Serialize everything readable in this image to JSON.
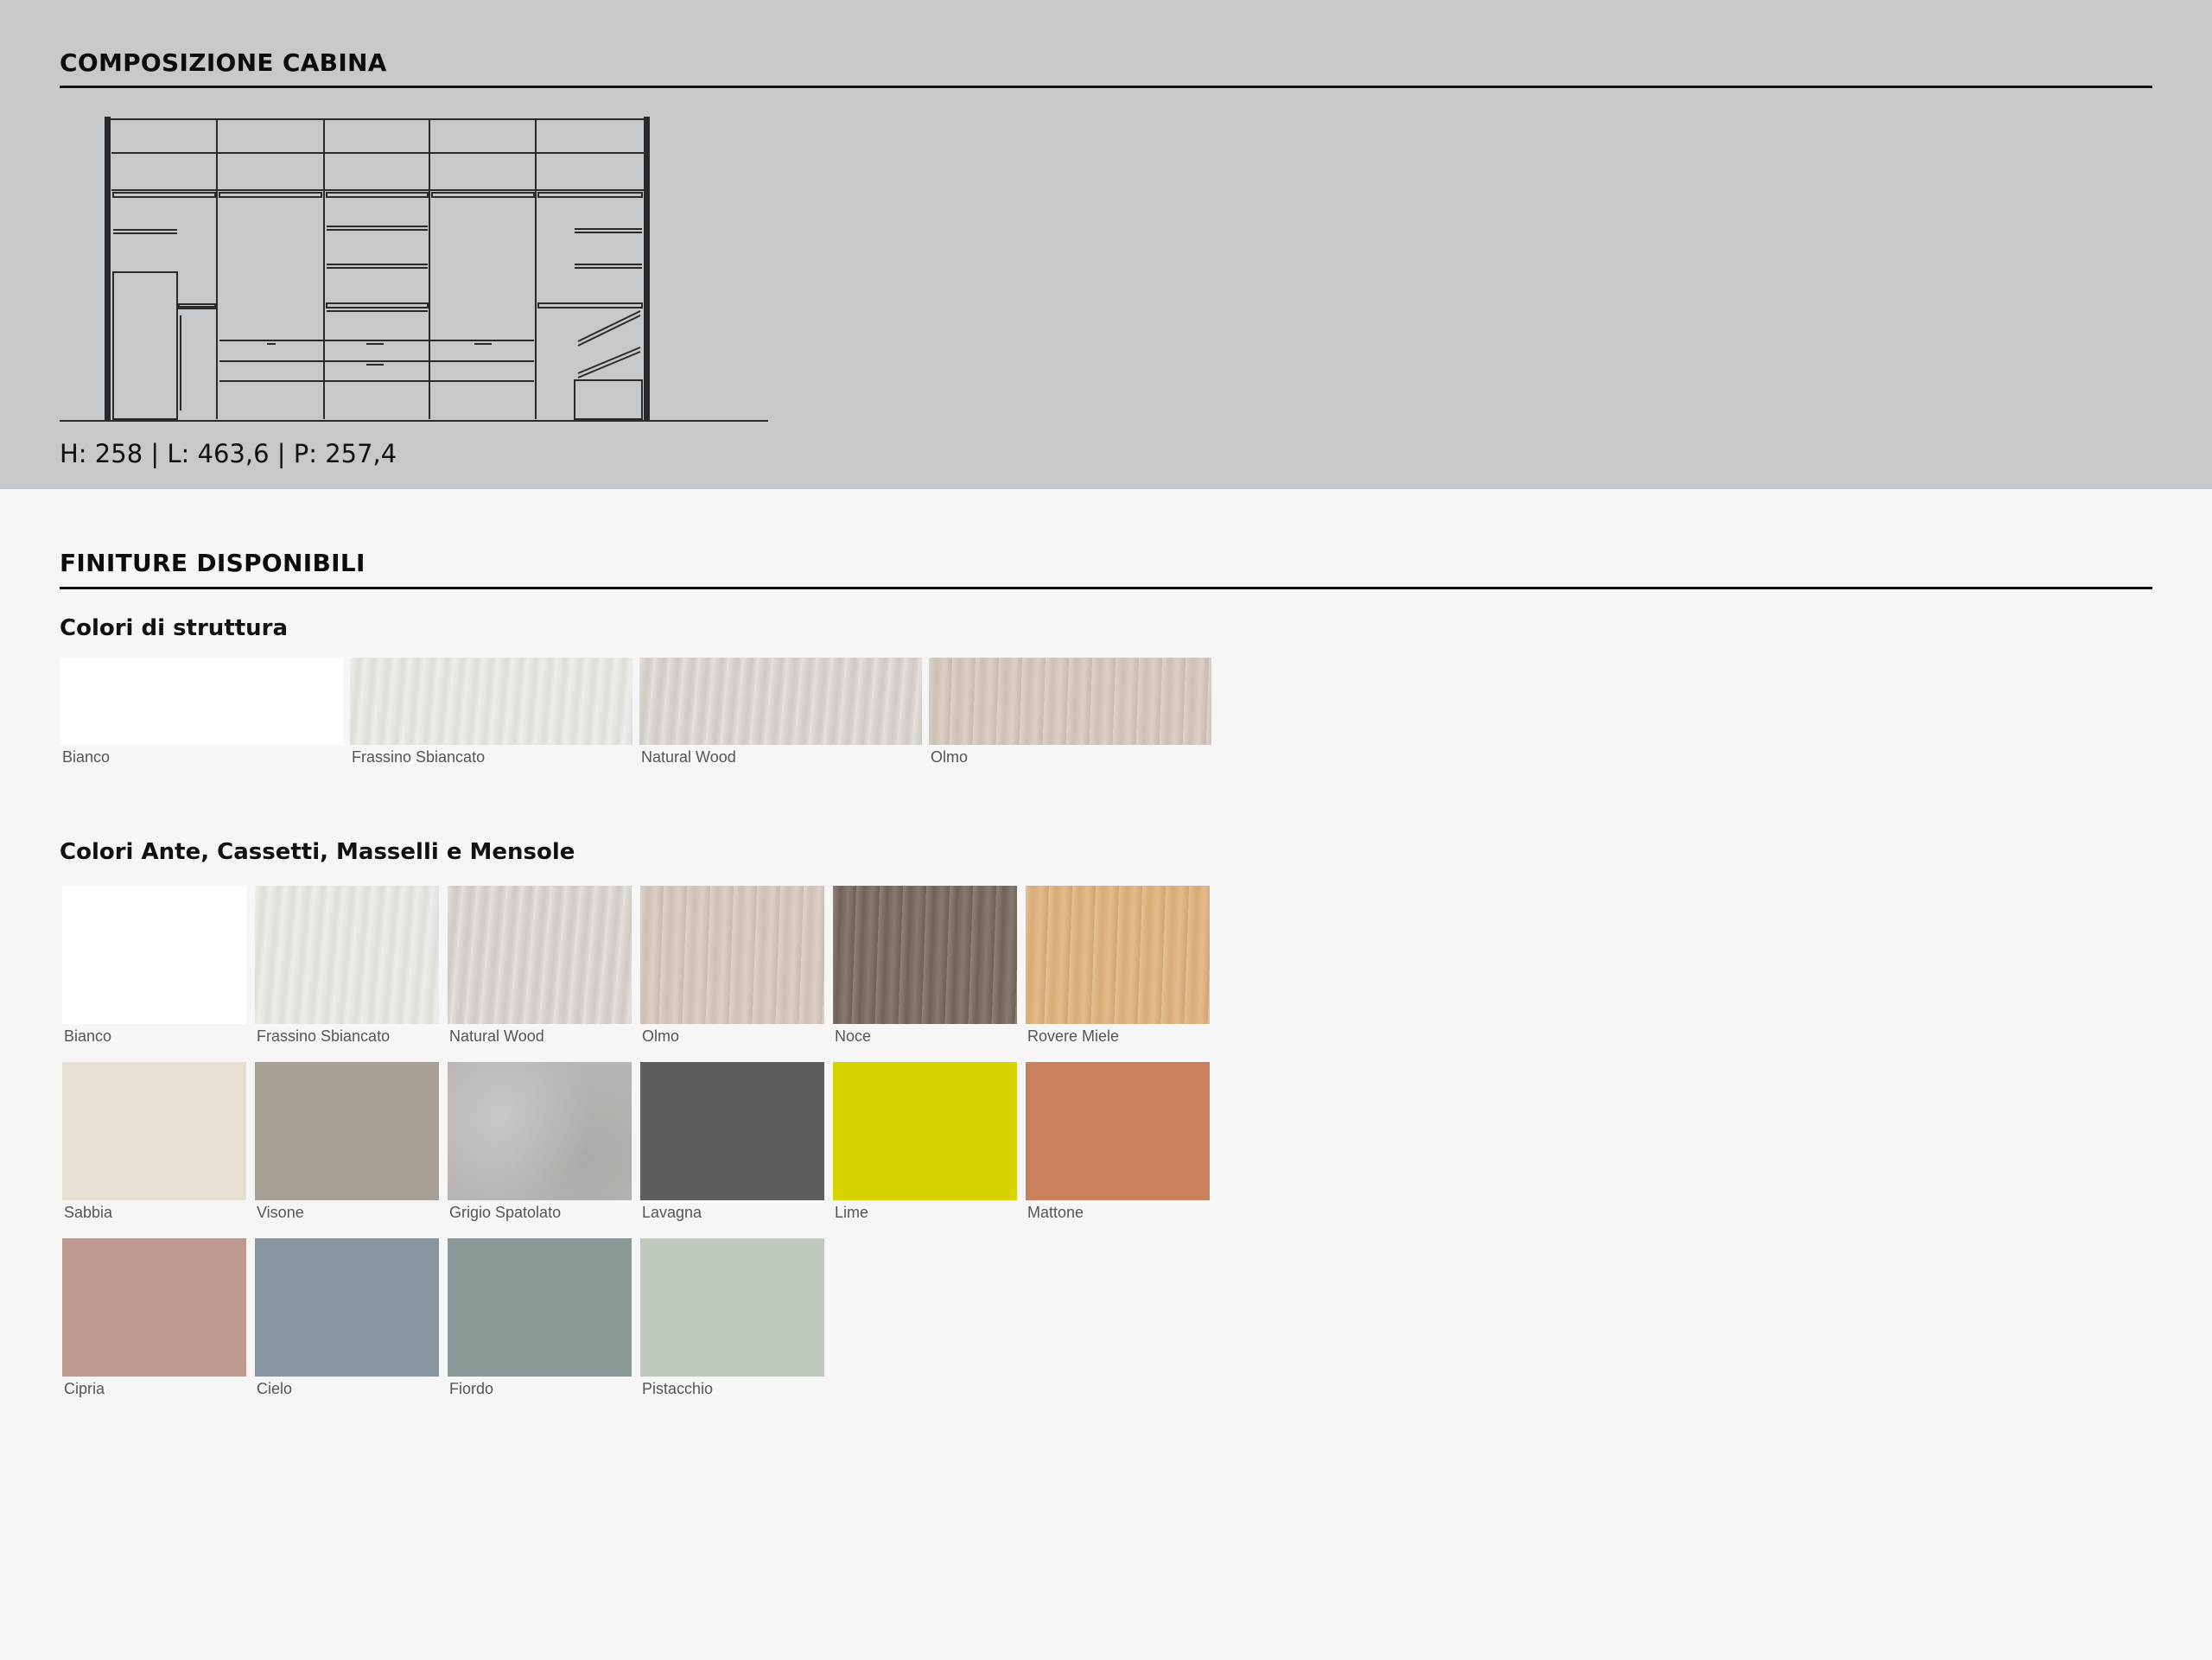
{
  "composition": {
    "title": "COMPOSIZIONE CABINA",
    "dimensions": "H: 258 | L: 463,6 | P: 257,4"
  },
  "finishes": {
    "title": "FINITURE DISPONIBILI",
    "structure": {
      "title": "Colori di struttura",
      "swatches": [
        {
          "label": "Bianco",
          "color": "#ffffff",
          "texture": "plain"
        },
        {
          "label": "Frassino Sbiancato",
          "color": "#e6e6e1",
          "texture": "wood-pale"
        },
        {
          "label": "Natural Wood",
          "color": "#d8d2cd",
          "texture": "wood-pale"
        },
        {
          "label": "Olmo",
          "color": "#d7c9bc",
          "texture": "wood-grain"
        }
      ]
    },
    "doors": {
      "title": "Colori Ante, Cassetti, Masselli e Mensole",
      "swatches": [
        {
          "label": "Bianco",
          "color": "#ffffff",
          "texture": "plain"
        },
        {
          "label": "Frassino Sbiancato",
          "color": "#e6e6e1",
          "texture": "wood-pale"
        },
        {
          "label": "Natural Wood",
          "color": "#d8d2cd",
          "texture": "wood-pale"
        },
        {
          "label": "Olmo",
          "color": "#d7c9bc",
          "texture": "wood-grain"
        },
        {
          "label": "Noce",
          "color": "#76675c",
          "texture": "wood-grain"
        },
        {
          "label": "Rovere Miele",
          "color": "#e2b27c",
          "texture": "wood-grain"
        },
        {
          "label": "Sabbia",
          "color": "#e7dfd1",
          "texture": "plain"
        },
        {
          "label": "Visone",
          "color": "#a9a096",
          "texture": "plain"
        },
        {
          "label": "Grigio Spatolato",
          "color": "#b8b4b1",
          "texture": "concrete"
        },
        {
          "label": "Lavagna",
          "color": "#5d5d5d",
          "texture": "plain"
        },
        {
          "label": "Lime",
          "color": "#d6d300",
          "texture": "plain"
        },
        {
          "label": "Mattone",
          "color": "#c9815d",
          "texture": "plain"
        },
        {
          "label": "Cipria",
          "color": "#bf9890",
          "texture": "plain"
        },
        {
          "label": "Cielo",
          "color": "#8896a2",
          "texture": "plain"
        },
        {
          "label": "Fiordo",
          "color": "#899a99",
          "texture": "plain"
        },
        {
          "label": "Pistacchio",
          "color": "#bfcabd",
          "texture": "plain"
        }
      ]
    }
  }
}
